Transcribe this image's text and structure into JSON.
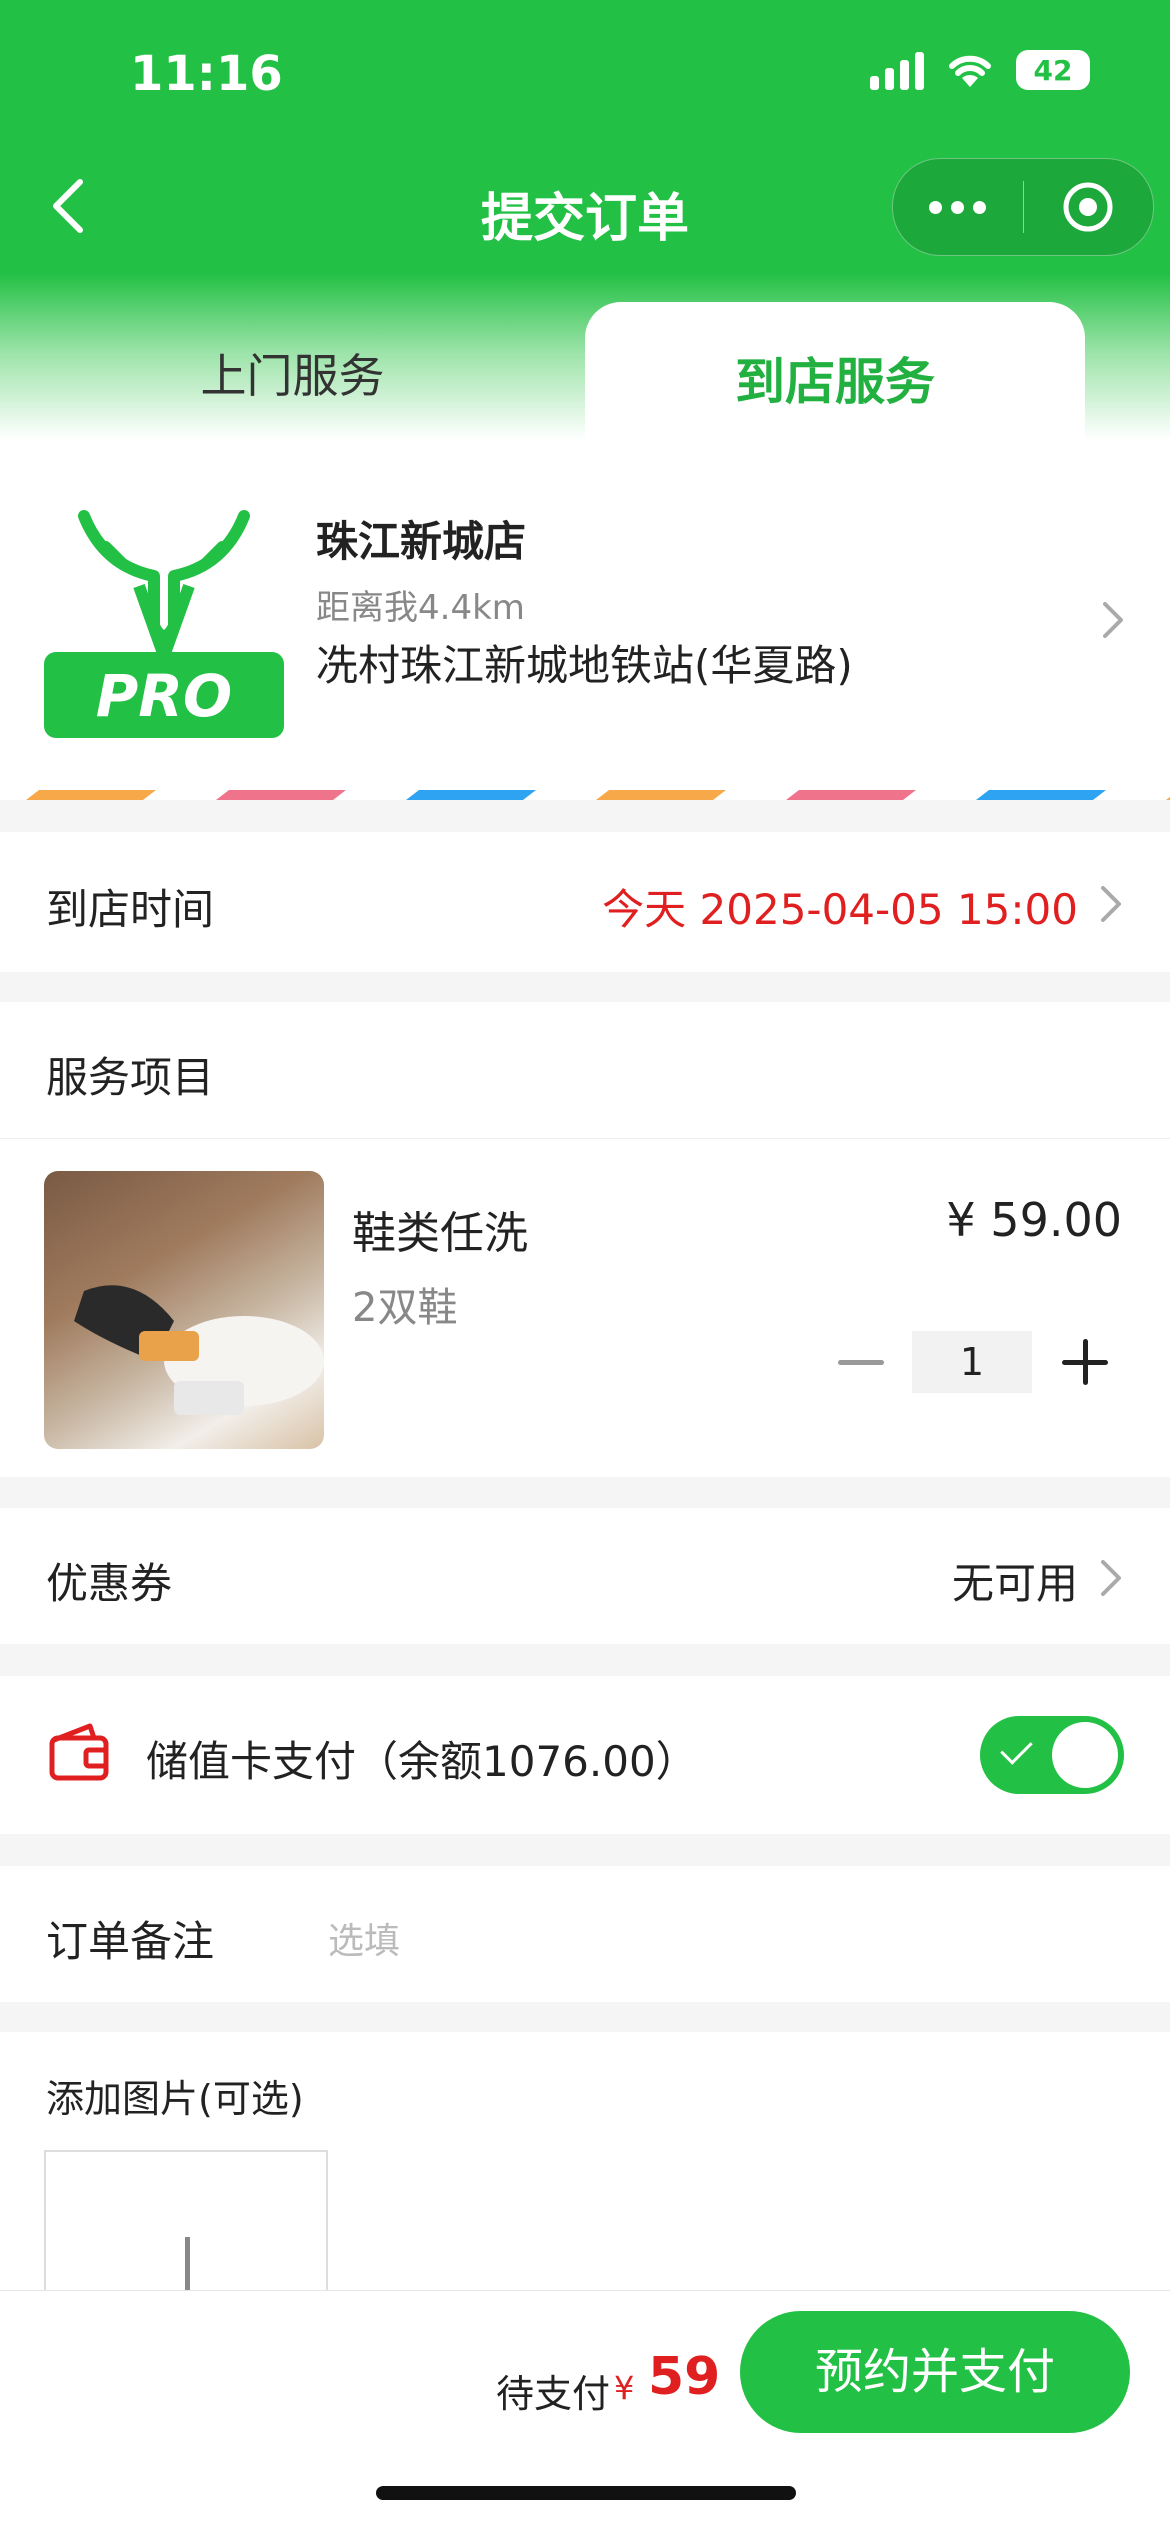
{
  "status_bar": {
    "time": "11:16",
    "battery": "42"
  },
  "nav": {
    "title": "提交订单"
  },
  "tabs": [
    {
      "label": "上门服务",
      "active": false
    },
    {
      "label": "到店服务",
      "active": true
    }
  ],
  "store": {
    "name": "珠江新城店",
    "distance": "距离我4.4km",
    "address": "冼村珠江新城地铁站(华夏路)",
    "logo_text": "PRO"
  },
  "arrival": {
    "label": "到店时间",
    "value": "今天 2025-04-05 15:00"
  },
  "service": {
    "section_label": "服务项目",
    "item": {
      "name": "鞋类任洗",
      "subtitle": "2双鞋",
      "price": "¥ 59.00",
      "quantity": "1"
    }
  },
  "coupon": {
    "label": "优惠券",
    "value": "无可用"
  },
  "stored_card": {
    "label": "储值卡支付（余额1076.00）",
    "enabled": true
  },
  "note": {
    "label": "订单备注",
    "placeholder": "选填"
  },
  "images": {
    "label": "添加图片(可选)"
  },
  "footer": {
    "pay_label": "待支付",
    "currency": "¥",
    "amount": "59",
    "submit_label": "预约并支付"
  },
  "colors": {
    "brand_green": "#22c044",
    "price_red": "#e02020",
    "stripe_orange": "#f7a94a",
    "stripe_pink": "#f0738c",
    "stripe_blue": "#2ea3f2"
  }
}
